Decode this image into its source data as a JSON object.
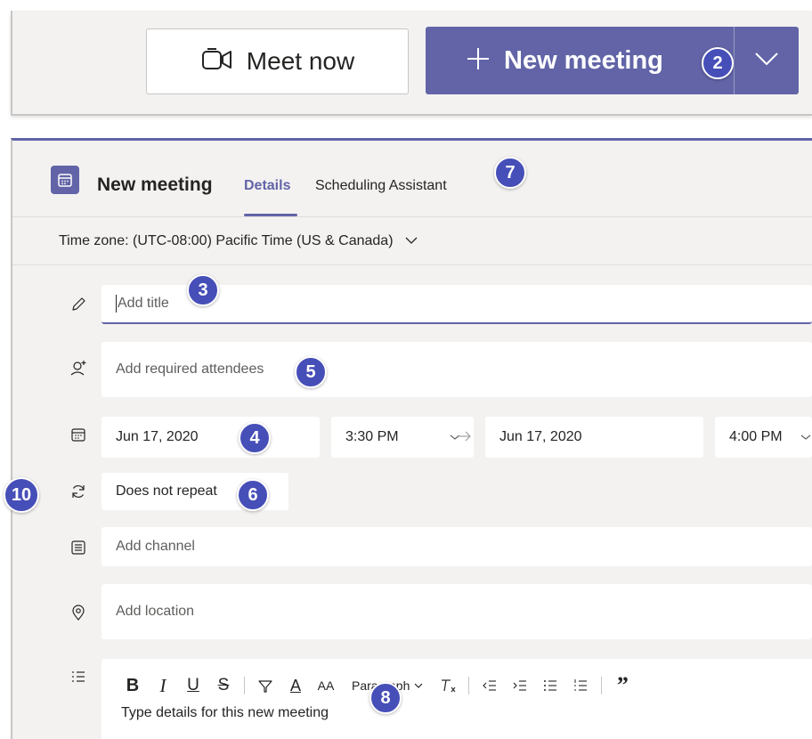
{
  "topbar": {
    "meet_now_label": "Meet now",
    "new_meeting_label": "New meeting"
  },
  "panel": {
    "title": "New meeting",
    "tabs": [
      {
        "label": "Details",
        "active": true
      },
      {
        "label": "Scheduling Assistant",
        "active": false
      }
    ],
    "timezone_label": "Time zone: (UTC-08:00) Pacific Time (US & Canada)"
  },
  "form": {
    "title_placeholder": "Add title",
    "attendees_placeholder": "Add required attendees",
    "start_date": "Jun 17, 2020",
    "start_time": "3:30 PM",
    "end_date": "Jun 17, 2020",
    "end_time": "4:00 PM",
    "repeat_label": "Does not repeat",
    "channel_placeholder": "Add channel",
    "location_placeholder": "Add location",
    "details_placeholder": "Type details for this new meeting"
  },
  "toolbar": {
    "bold": "B",
    "italic": "I",
    "underline": "U",
    "strikethrough": "S",
    "font_color": "A",
    "font_size": "AA",
    "paragraph_label": "Paragraph",
    "blockquote": "”"
  },
  "badges": {
    "b2": "2",
    "b3": "3",
    "b4": "4",
    "b5": "5",
    "b6": "6",
    "b7": "7",
    "b8": "8",
    "b10": "10"
  },
  "colors": {
    "accent": "#6264a7",
    "badge": "#464eb8",
    "surface": "#f3f2f1",
    "field": "#ffffff"
  },
  "icons": [
    "video-icon",
    "plus-icon",
    "chevron-down-icon",
    "calendar-icon",
    "pencil-icon",
    "add-person-icon",
    "repeat-icon",
    "channel-icon",
    "location-icon",
    "list-icon"
  ]
}
